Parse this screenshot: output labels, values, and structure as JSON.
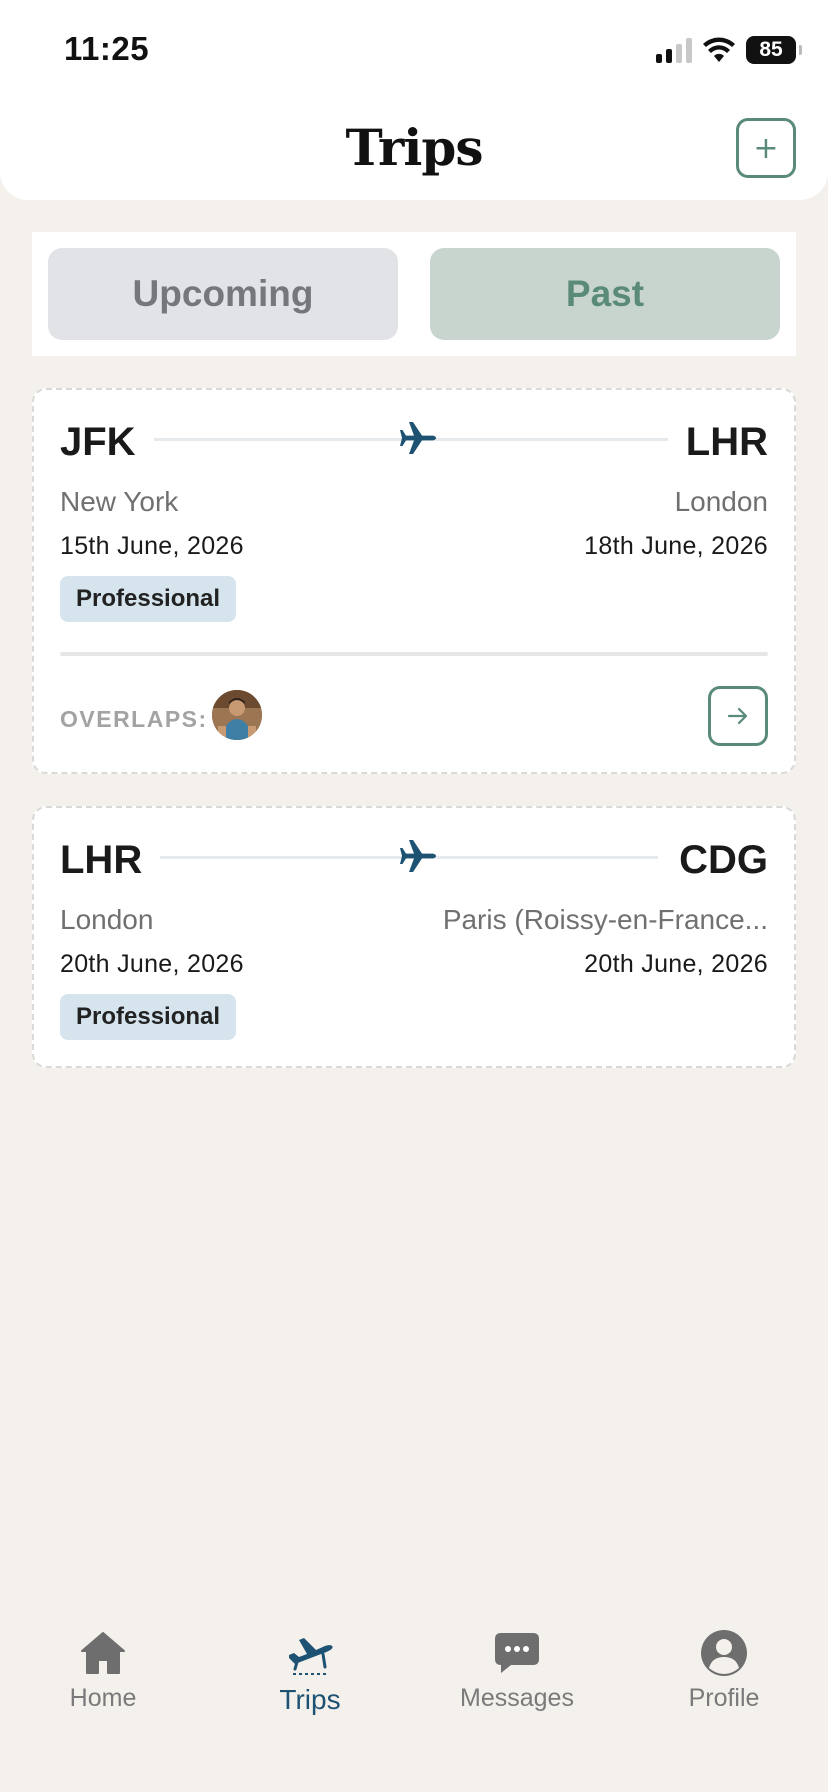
{
  "status_bar": {
    "time": "11:25",
    "battery": "85"
  },
  "header": {
    "title": "Trips",
    "add_label": "+"
  },
  "tabs_filter": {
    "upcoming": "Upcoming",
    "past": "Past",
    "selected": "Past"
  },
  "trips": [
    {
      "from_code": "JFK",
      "to_code": "LHR",
      "from_city": "New York",
      "to_city": "London",
      "from_date": "15th June, 2026",
      "to_date": "18th June, 2026",
      "tag": "Professional",
      "overlaps_label": "OVERLAPS:"
    },
    {
      "from_code": "LHR",
      "to_code": "CDG",
      "from_city": "London",
      "to_city": "Paris (Roissy-en-France...",
      "from_date": "20th June, 2026",
      "to_date": "20th June, 2026",
      "tag": "Professional"
    }
  ],
  "nav": {
    "home": "Home",
    "trips": "Trips",
    "messages": "Messages",
    "profile": "Profile",
    "active": "Trips"
  },
  "colors": {
    "accent_green": "#5a8a78",
    "accent_blue": "#1d5272",
    "background": "#f4f1ec",
    "tag_bg": "#d6e4ee"
  }
}
